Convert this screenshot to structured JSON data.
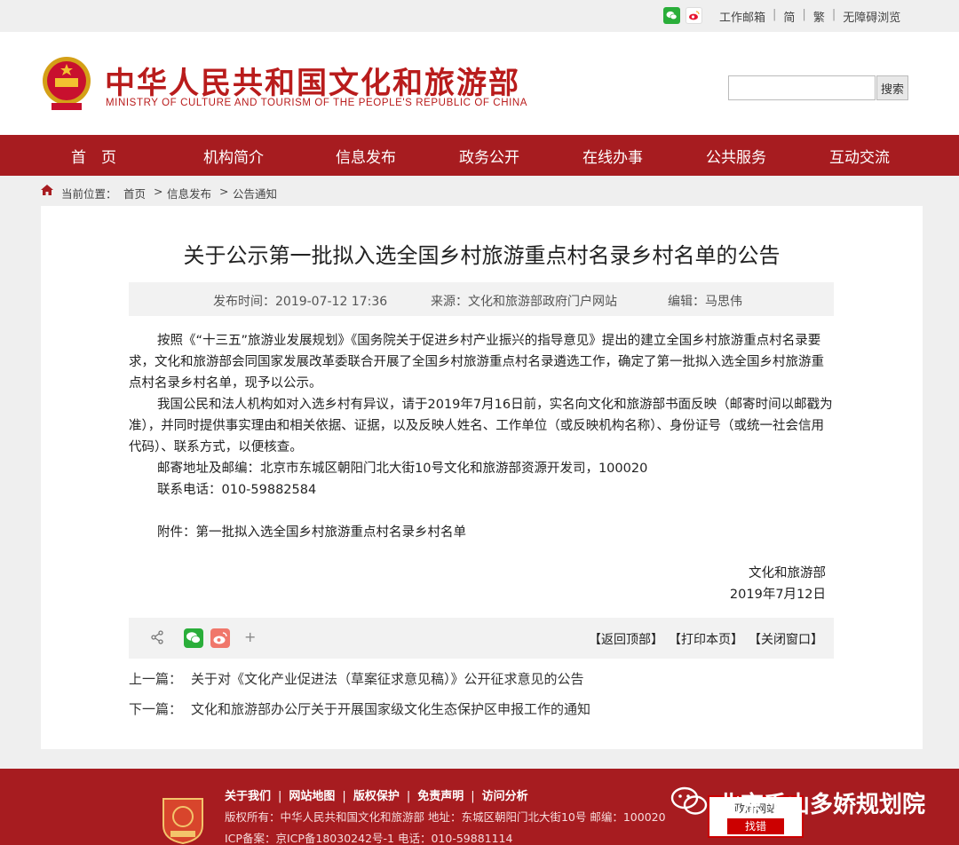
{
  "topbar": {
    "links": [
      "工作邮箱",
      "简",
      "繁",
      "无障碍浏览"
    ]
  },
  "header": {
    "title": "中华人民共和国文化和旅游部",
    "subtitle": "MINISTRY OF CULTURE AND TOURISM OF THE PEOPLE'S REPUBLIC OF CHINA",
    "search_placeholder": "",
    "search_button": "搜索"
  },
  "nav": {
    "items": [
      "首　页",
      "机构简介",
      "信息发布",
      "政务公开",
      "在线办事",
      "公共服务",
      "互动交流"
    ]
  },
  "breadcrumb": {
    "label": "当前位置：",
    "items": [
      "首页",
      "信息发布",
      "公告通知"
    ],
    "separator": ">"
  },
  "article": {
    "title": "关于公示第一批拟入选全国乡村旅游重点村名录乡村名单的公告",
    "publish_time": "发布时间：2019-07-12 17:36",
    "source": "来源：文化和旅游部政府门户网站",
    "editor": "编辑：马思伟",
    "paragraphs": [
      "按照《“十三五”旅游业发展规划》《国务院关于促进乡村产业振兴的指导意见》提出的建立全国乡村旅游重点村名录要求，文化和旅游部会同国家发展改革委联合开展了全国乡村旅游重点村名录遴选工作，确定了第一批拟入选全国乡村旅游重点村名录乡村名单，现予以公示。",
      "我国公民和法人机构如对入选乡村有异议，请于2019年7月16日前，实名向文化和旅游部书面反映（邮寄时间以邮戳为准），并同时提供事实理由和相关依据、证据，以及反映人姓名、工作单位（或反映机构名称）、身份证号（或统一社会信用代码）、联系方式，以便核查。",
      "邮寄地址及邮编：北京市东城区朝阳门北大街10号文化和旅游部资源开发司，100020",
      "联系电话：010-59882584"
    ],
    "attachment": "附件：第一批拟入选全国乡村旅游重点村名录乡村名单",
    "signature_org": "文化和旅游部",
    "signature_date": "2019年7月12日"
  },
  "toolbar": {
    "plus": "+",
    "back_top": "【返回顶部】",
    "print": "【打印本页】",
    "close": "【关闭窗口】"
  },
  "prevnext": {
    "prev_label": "上一篇：",
    "prev_title": "关于对《文化产业促进法（草案征求意见稿）》公开征求意见的公告",
    "next_label": "下一篇：",
    "next_title": "文化和旅游部办公厅关于开展国家级文化生态保护区申报工作的通知"
  },
  "footer": {
    "links": [
      "关于我们",
      "网站地图",
      "版权保护",
      "免责声明",
      "访问分析"
    ],
    "copyright": "版权所有：中华人民共和国文化和旅游部  地址：东城区朝阳门北大街10号  邮编：100020",
    "icp": "ICP备案：京ICP备18030242号-1  电话：010-59881114",
    "watermark": "北京千山多娇规划院",
    "gov_box_top": "政府网站",
    "gov_box_btn": "找错"
  },
  "colors": {
    "brand_red": "#a71c20",
    "title_red": "#b91c1c"
  }
}
